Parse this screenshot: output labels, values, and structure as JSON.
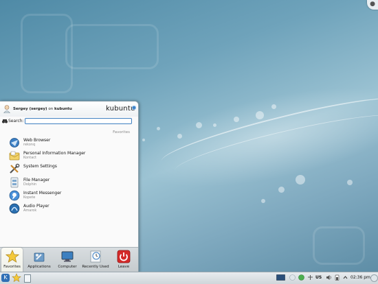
{
  "menu": {
    "user_name": "Sergey (sergey)",
    "user_on": "on",
    "host": "kubuntu",
    "brand": "kubuntu",
    "search_label": "Search:",
    "search_value": "",
    "section_caption": "Favorites",
    "entries": [
      {
        "name": "Web Browser",
        "sub": "rekonq",
        "icon": "web-browser-icon"
      },
      {
        "name": "Personal Information Manager",
        "sub": "Kontact",
        "icon": "pim-icon"
      },
      {
        "name": "System Settings",
        "sub": "",
        "icon": "system-settings-icon"
      },
      {
        "name": "File Manager",
        "sub": "Dolphin",
        "icon": "file-manager-icon"
      },
      {
        "name": "Instant Messenger",
        "sub": "Kopete",
        "icon": "instant-messenger-icon"
      },
      {
        "name": "Audio Player",
        "sub": "Amarok",
        "icon": "audio-player-icon"
      }
    ],
    "tabs": [
      {
        "label": "Favorites",
        "active": true
      },
      {
        "label": "Applications",
        "active": false
      },
      {
        "label": "Computer",
        "active": false
      },
      {
        "label": "Recently Used",
        "active": false
      },
      {
        "label": "Leave",
        "active": false
      }
    ]
  },
  "panel": {
    "keyboard_layout": "US",
    "clock": "02:36 pm"
  },
  "colors": {
    "accent": "#3b7fc4",
    "leave_red": "#d42a2a",
    "desktop": "#6fa3bb"
  }
}
